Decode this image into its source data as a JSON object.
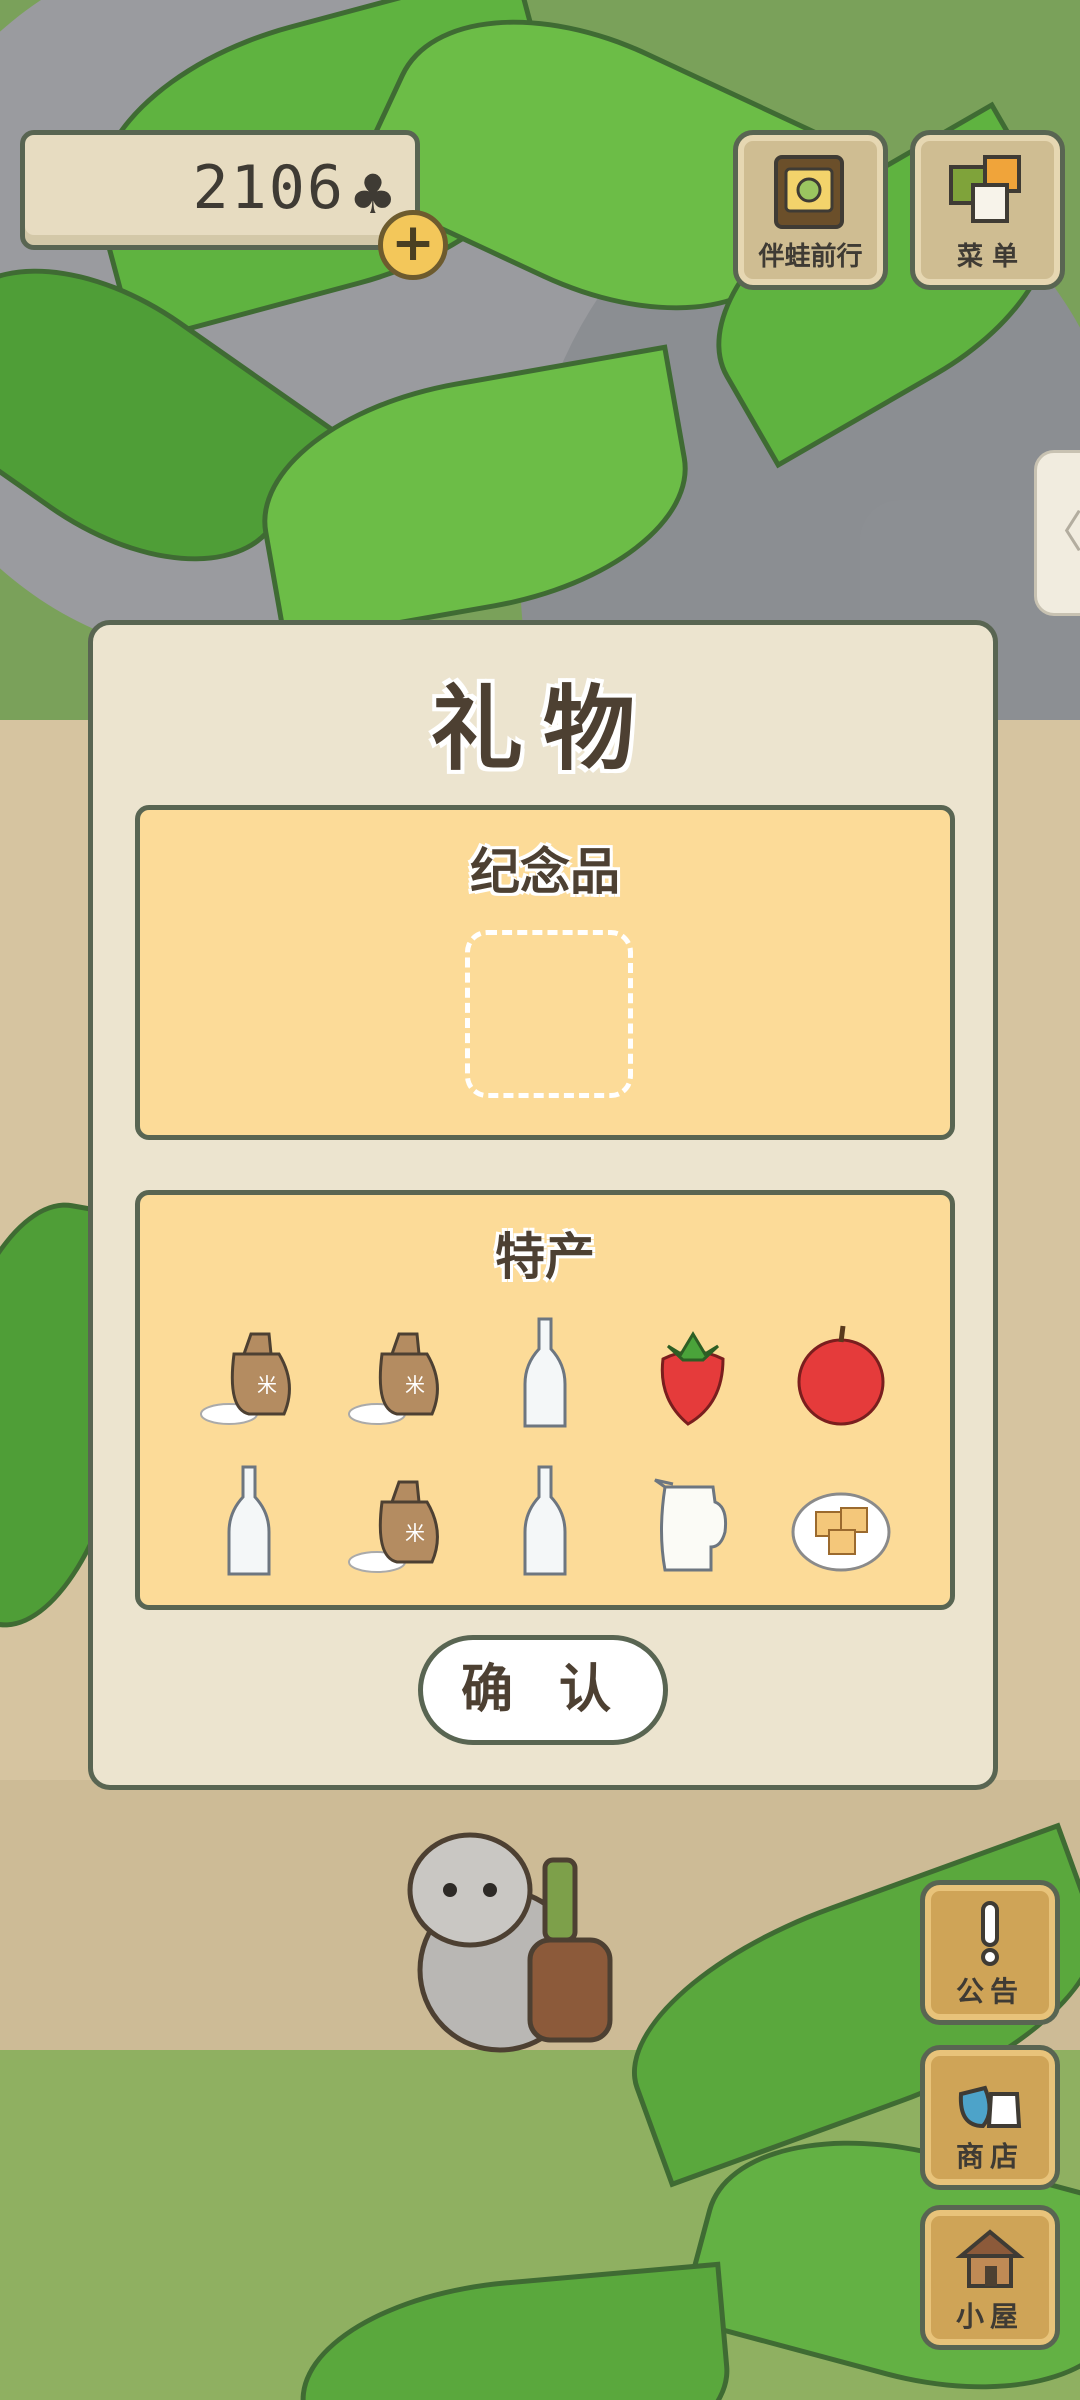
{
  "hud": {
    "clover_count": "2106",
    "clover_icon": "clover-icon",
    "plus_label": "+"
  },
  "top_buttons": [
    {
      "label": "伴蛙前行",
      "icon": "frog-album-icon"
    },
    {
      "label": "菜 单",
      "icon": "menu-cards-icon"
    }
  ],
  "side_tab": {
    "glyph": "〈"
  },
  "dialog": {
    "title": "礼物",
    "souvenir": {
      "title": "纪念品"
    },
    "specialty": {
      "title": "特产",
      "items": [
        "rice-bag-icon",
        "rice-bag-icon",
        "glass-bottle-icon",
        "strawberry-icon",
        "apple-icon",
        "glass-bottle-icon",
        "rice-bag-icon",
        "glass-bottle-icon",
        "milk-jug-icon",
        "tofu-plate-icon"
      ]
    },
    "confirm_label": "确 认"
  },
  "side_buttons": [
    {
      "label": "公告",
      "icon": "exclamation-icon"
    },
    {
      "label": "商店",
      "icon": "shop-bags-icon"
    },
    {
      "label": "小屋",
      "icon": "house-icon"
    }
  ],
  "colors": {
    "dialog_bg": "#ece4cf",
    "panel_bg": "#fcdb98",
    "outline": "#596552",
    "side_button": "#cfa457"
  }
}
